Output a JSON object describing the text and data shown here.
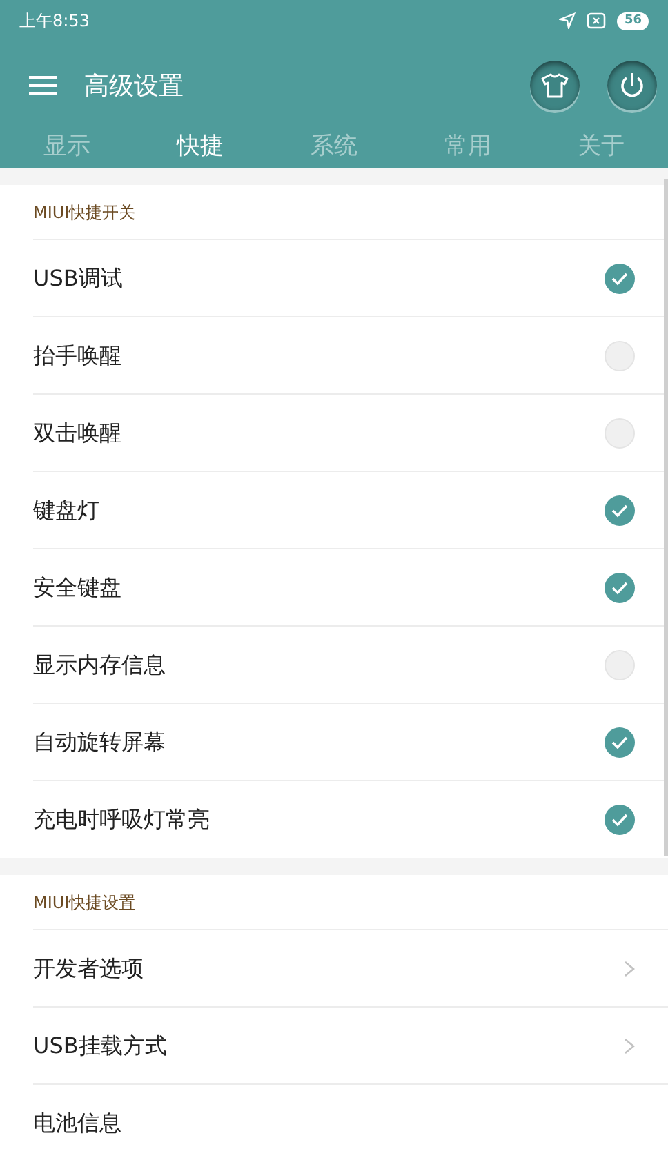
{
  "status_bar": {
    "time": "上午8:53",
    "battery": "56"
  },
  "header": {
    "title": "高级设置"
  },
  "tabs": [
    {
      "label": "显示",
      "selected": false
    },
    {
      "label": "快捷",
      "selected": true
    },
    {
      "label": "系统",
      "selected": false
    },
    {
      "label": "常用",
      "selected": false
    },
    {
      "label": "关于",
      "selected": false
    }
  ],
  "sections": [
    {
      "title": "MIUI快捷开关",
      "items": [
        {
          "kind": "toggle",
          "label": "USB调试",
          "checked": true
        },
        {
          "kind": "toggle",
          "label": "抬手唤醒",
          "checked": false
        },
        {
          "kind": "toggle",
          "label": "双击唤醒",
          "checked": false
        },
        {
          "kind": "toggle",
          "label": "键盘灯",
          "checked": true
        },
        {
          "kind": "toggle",
          "label": "安全键盘",
          "checked": true
        },
        {
          "kind": "toggle",
          "label": "显示内存信息",
          "checked": false
        },
        {
          "kind": "toggle",
          "label": "自动旋转屏幕",
          "checked": true
        },
        {
          "kind": "toggle",
          "label": "充电时呼吸灯常亮",
          "checked": true
        }
      ]
    },
    {
      "title": "MIUI快捷设置",
      "items": [
        {
          "kind": "link",
          "label": "开发者选项",
          "chevron": true
        },
        {
          "kind": "link",
          "label": "USB挂载方式",
          "chevron": true
        },
        {
          "kind": "link",
          "label": "电池信息",
          "chevron": false
        }
      ]
    }
  ]
}
